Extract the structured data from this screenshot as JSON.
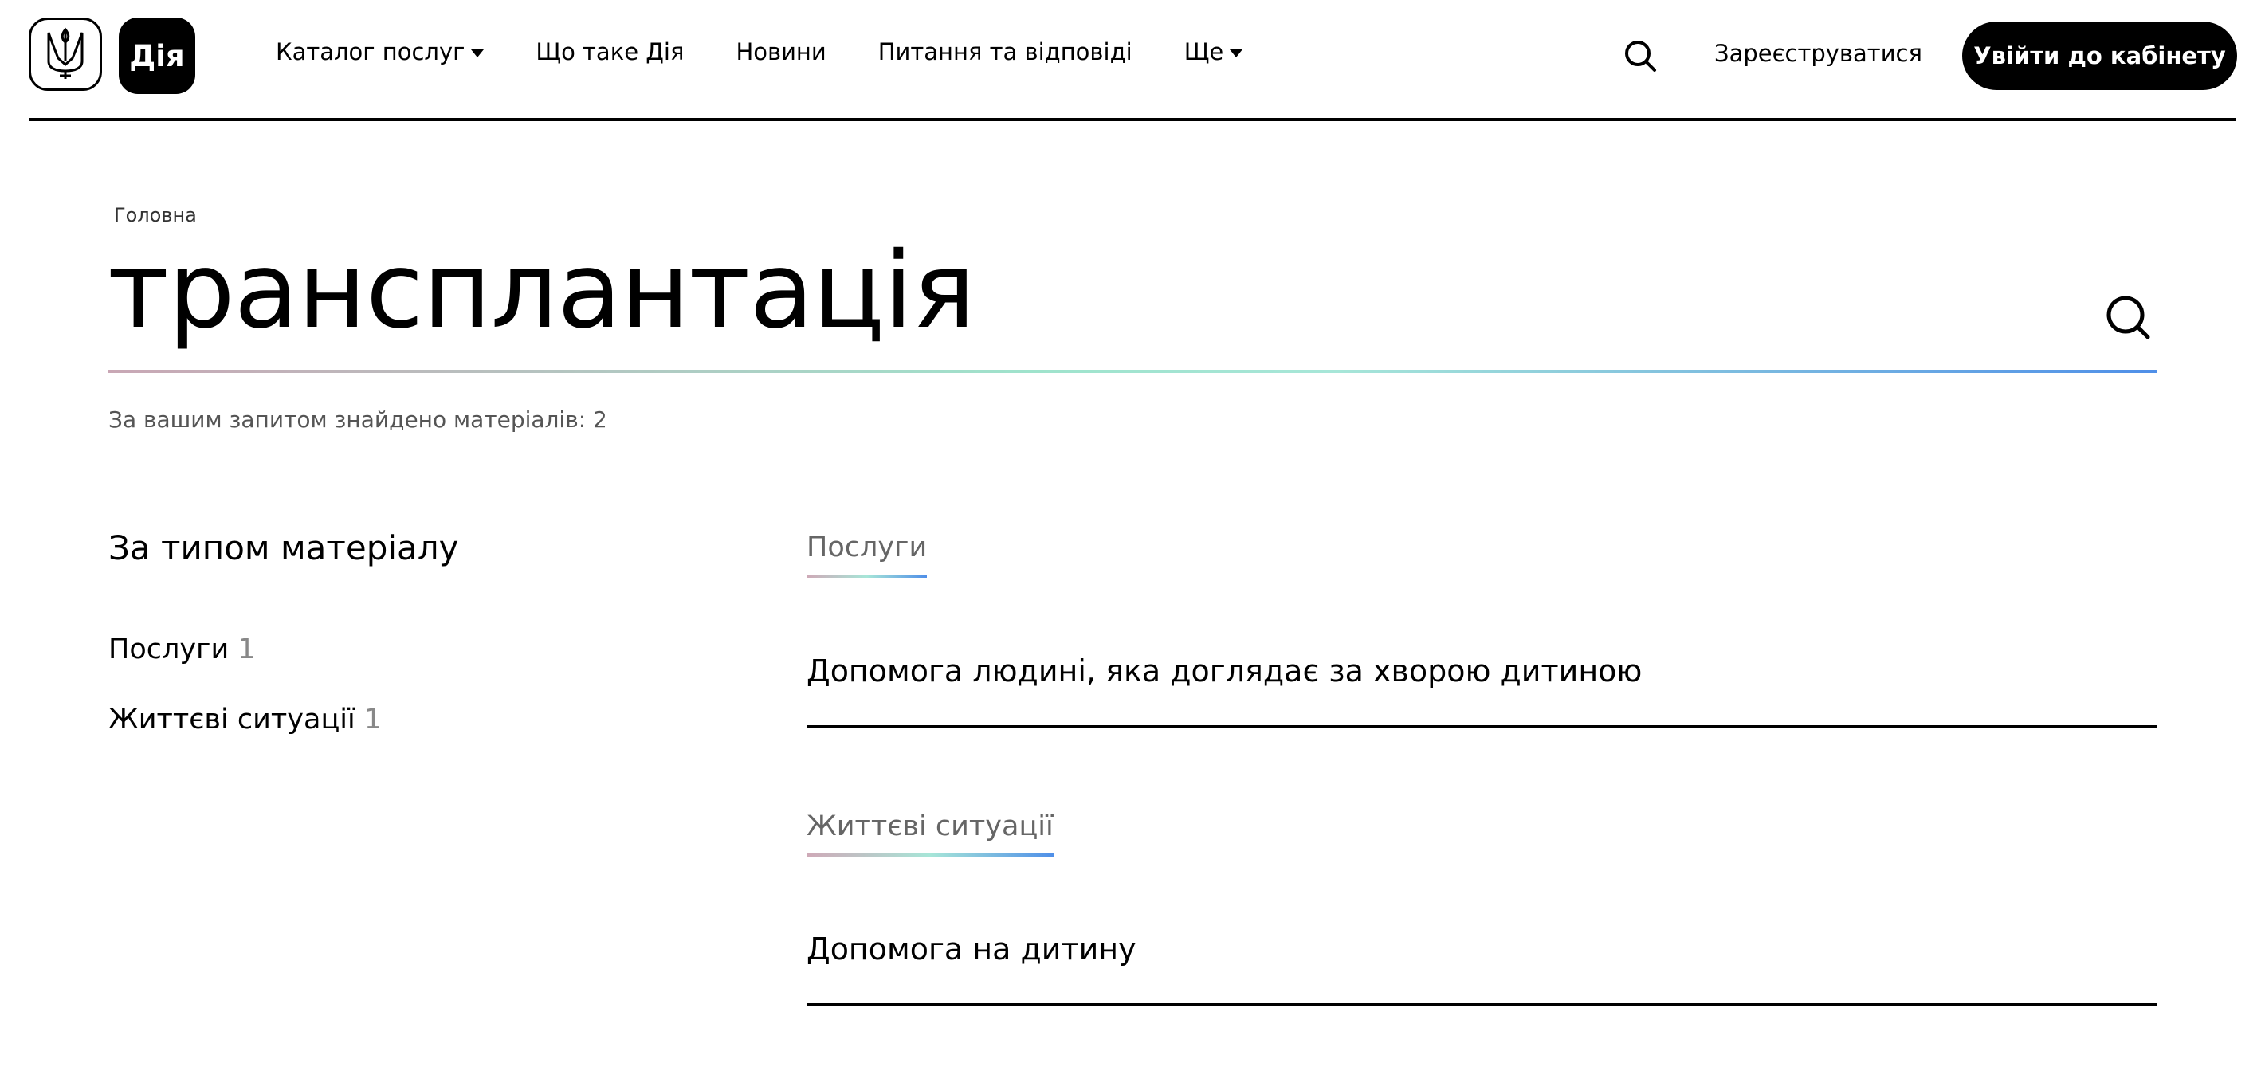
{
  "header": {
    "logo_text": "Дія",
    "nav": [
      {
        "label": "Каталог послуг",
        "dropdown": true
      },
      {
        "label": "Що таке Дія",
        "dropdown": false
      },
      {
        "label": "Новини",
        "dropdown": false
      },
      {
        "label": "Питання та відповіді",
        "dropdown": false
      },
      {
        "label": "Ще",
        "dropdown": true
      }
    ],
    "register_label": "Зареєструватися",
    "login_label": "Увійти до кабінету"
  },
  "breadcrumb": "Головна",
  "search": {
    "query": "трансплантація",
    "result_count": "За вашим запитом знайдено матеріалів: 2"
  },
  "filters": {
    "heading": "За типом матеріалу",
    "items": [
      {
        "label": "Послуги",
        "count": "1"
      },
      {
        "label": "Життєві ситуації",
        "count": "1"
      }
    ]
  },
  "results": [
    {
      "section": "Послуги",
      "items": [
        "Допомога людині, яка доглядає за хворою дитиною"
      ]
    },
    {
      "section": "Життєві ситуації",
      "items": [
        "Допомога на дитину"
      ]
    }
  ],
  "colors": {
    "primary": "#000000",
    "muted": "#666666",
    "gradient_start": "#c9a7b5",
    "gradient_mid": "#a7e6d8",
    "gradient_end": "#4f8fe8"
  }
}
